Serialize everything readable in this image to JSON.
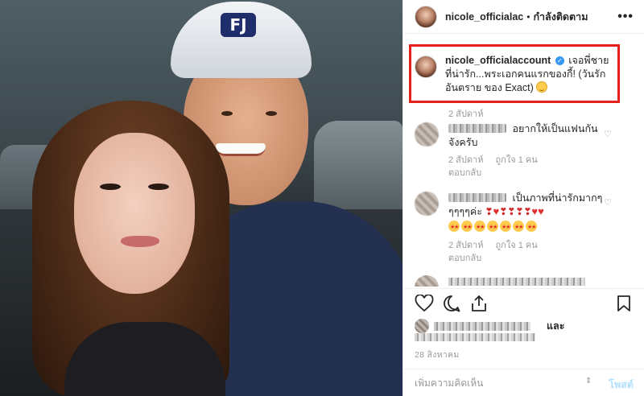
{
  "post": {
    "username": "nicole_officialac",
    "follow_status": "กำลังติดตาม",
    "separator": "•",
    "more_label": "•••"
  },
  "caption": {
    "username": "nicole_officialaccount",
    "text": "เจอพี่ชายที่น่ารัก...พระเอกคนแรกของกี้! (วันรักอันตราย ของ Exact)",
    "time": "2 สัปดาห์"
  },
  "comments": [
    {
      "text": "อยากให้เป็นแฟนกันจังครับ",
      "time": "2 สัปดาห์",
      "likes": "ถูกใจ 1 คน",
      "reply": "ตอบกลับ"
    },
    {
      "text": "เป็นภาพที่น่ารักมากๆๆๆๆๆค่ะ",
      "time": "2 สัปดาห์",
      "likes": "ถูกใจ 1 คน",
      "reply": "ตอบกลับ"
    }
  ],
  "likes_suffix": "และ",
  "date": "28 สิงหาคม",
  "add_comment": {
    "placeholder": "เพิ่มความคิดเห็น",
    "post_label": "โพสต์"
  },
  "photo": {
    "cap_logo": "FJ"
  },
  "icons": {
    "heart": "heart-icon",
    "comment": "comment-icon",
    "share": "share-icon",
    "save": "bookmark-icon",
    "verified": "verified-badge-icon"
  },
  "colors": {
    "highlight": "#e4201b",
    "verified": "#3897f0",
    "post_disabled": "#b2dffc"
  }
}
